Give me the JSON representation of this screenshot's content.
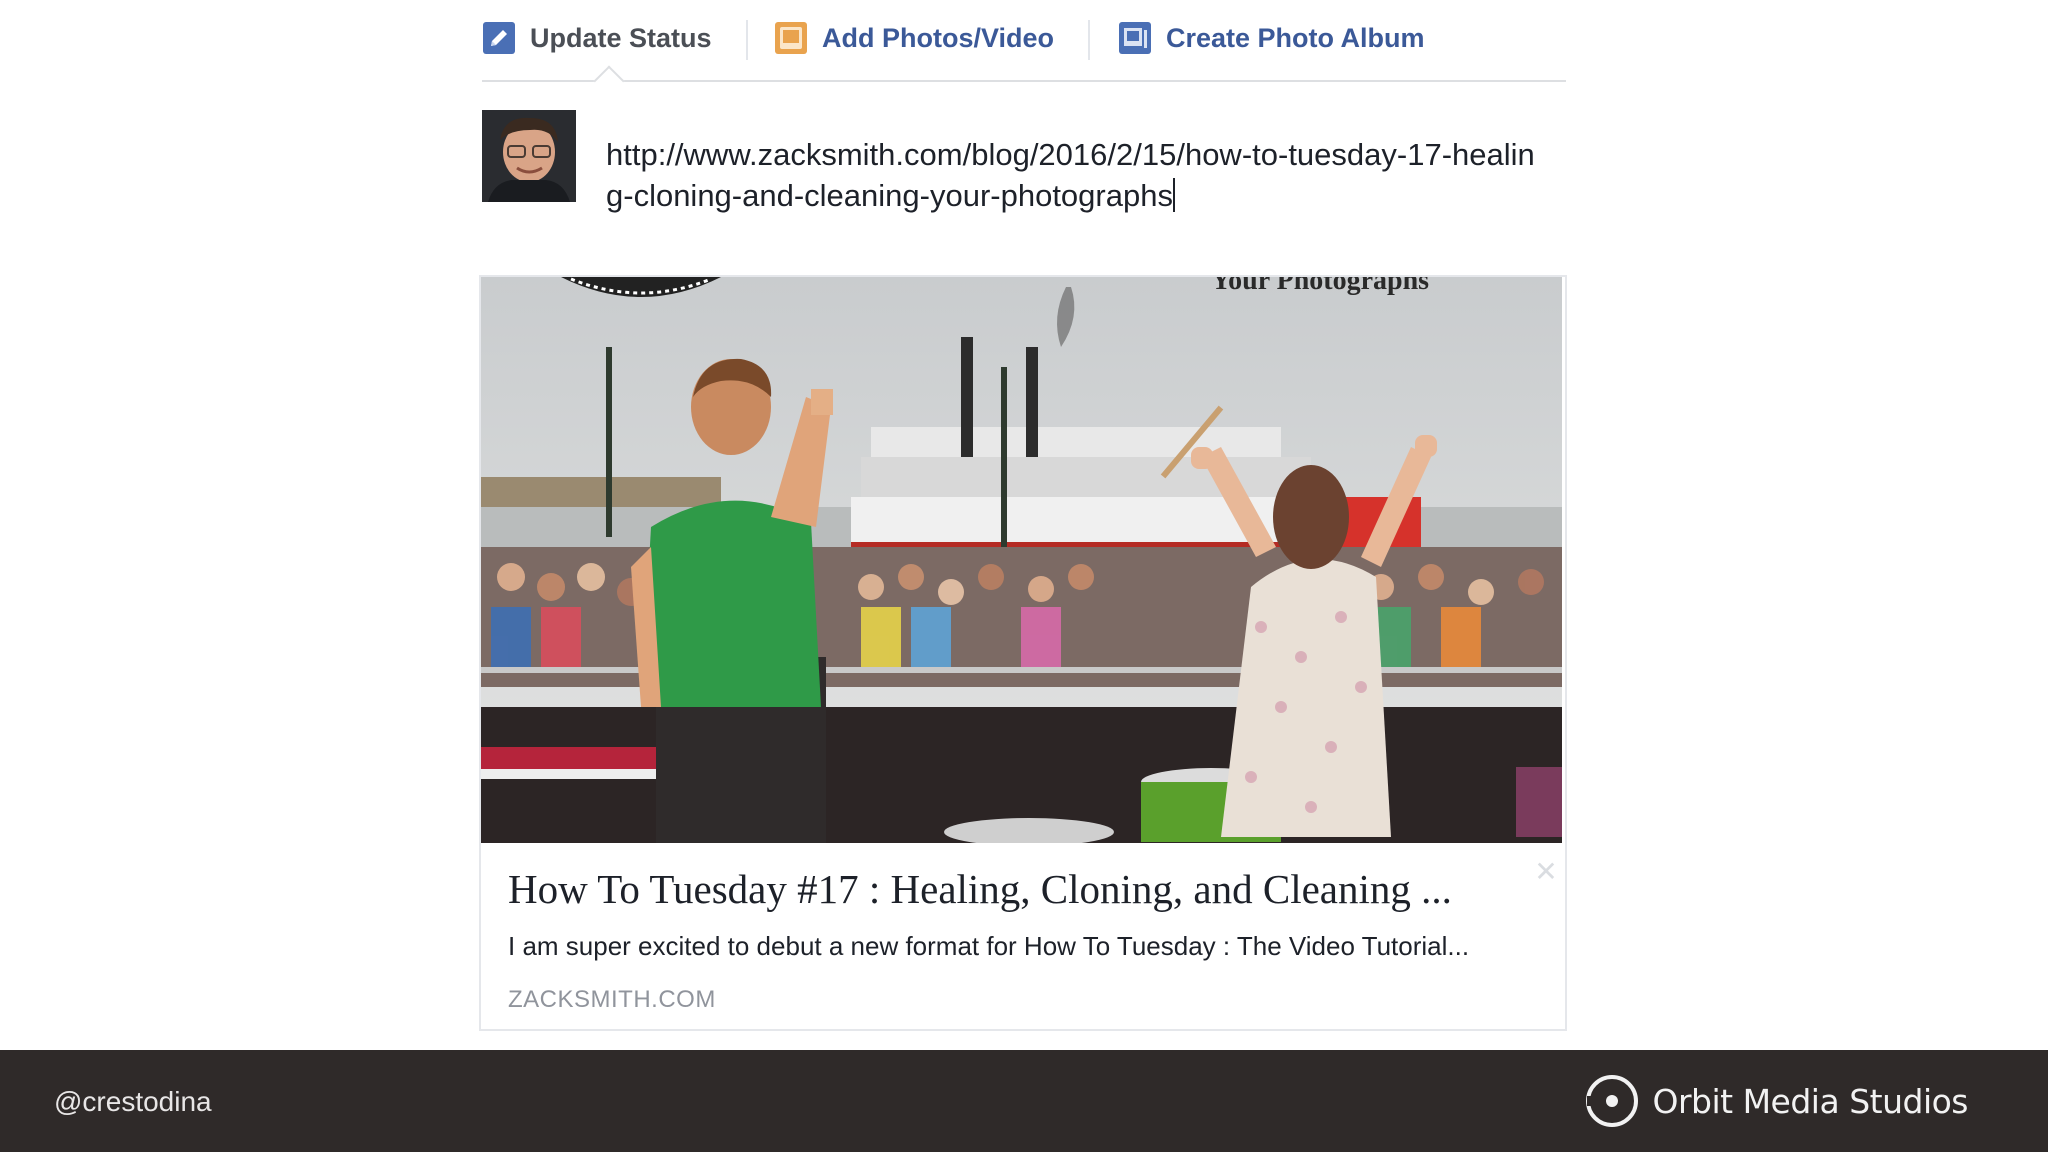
{
  "composer": {
    "tabs": [
      {
        "label": "Update Status",
        "icon": "pencil-icon"
      },
      {
        "label": "Add Photos/Video",
        "icon": "photo-icon"
      },
      {
        "label": "Create Photo Album",
        "icon": "album-icon"
      }
    ],
    "text": "http://www.zacksmith.com/blog/2016/2/15/how-to-tuesday-17-healing-cloning-and-cleaning-your-photographs"
  },
  "link_preview": {
    "image_overlay_text": "Your Photographs",
    "title": "How To Tuesday #17 : Healing, Cloning, and Cleaning ...",
    "description": "I am super excited to debut a new format for How To Tuesday : The Video Tutorial...",
    "domain": "ZACKSMITH.COM",
    "close_symbol": "✕"
  },
  "footer": {
    "handle": "@crestodina",
    "brand": "Orbit Media Studios"
  },
  "colors": {
    "link_blue": "#3b5998",
    "footer_bg": "#2f2a29"
  }
}
